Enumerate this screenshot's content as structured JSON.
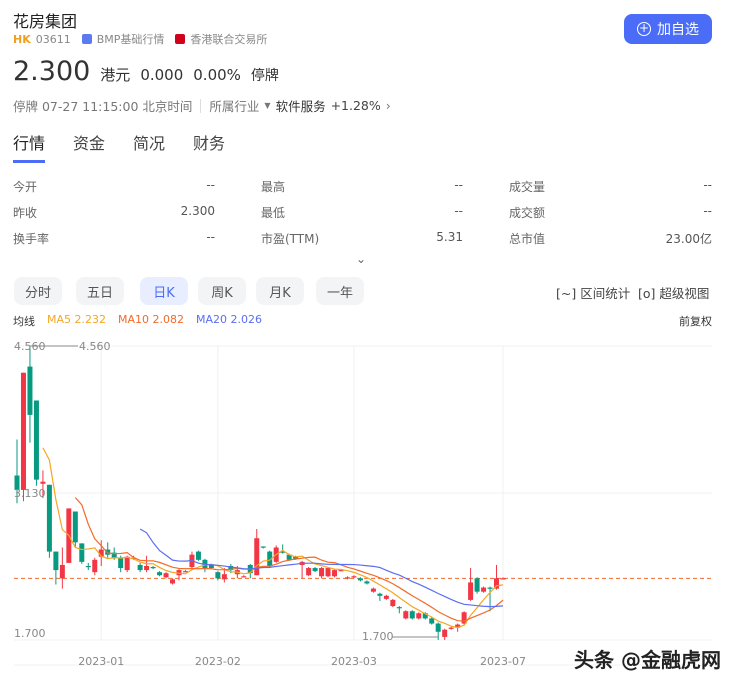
{
  "header": {
    "title": "花房集团",
    "market": "HK",
    "code": "03611",
    "feed": "BMP基础行情",
    "exchange": "香港联合交易所",
    "add_button": "加自选"
  },
  "quote": {
    "price": "2.300",
    "currency": "港元",
    "change": "0.000",
    "change_pct": "0.00%",
    "state": "停牌",
    "status_time": "停牌 07-27 11:15:00 北京时间",
    "industry_label": "所属行业",
    "industry": "软件服务",
    "industry_change": "+1.28%"
  },
  "tabs": [
    "行情",
    "资金",
    "简况",
    "财务"
  ],
  "stats": [
    [
      {
        "label": "今开",
        "value": "--"
      },
      {
        "label": "最高",
        "value": "--"
      },
      {
        "label": "成交量",
        "value": "--"
      }
    ],
    [
      {
        "label": "昨收",
        "value": "2.300"
      },
      {
        "label": "最低",
        "value": "--"
      },
      {
        "label": "成交额",
        "value": "--"
      }
    ],
    [
      {
        "label": "换手率",
        "value": "--"
      },
      {
        "label": "市盈(TTM)",
        "value": "5.31"
      },
      {
        "label": "总市值",
        "value": "23.00亿"
      }
    ]
  ],
  "periods": [
    "分时",
    "五日",
    "日K",
    "周K",
    "月K",
    "一年"
  ],
  "tools": {
    "range": "区间统计",
    "super": "超级视图"
  },
  "ma": {
    "label": "均线",
    "ma5": "MA5 2.232",
    "ma10": "MA10 2.082",
    "ma20": "MA20 2.026",
    "adjust": "前复权"
  },
  "watermark": "头条 @金融虎网",
  "colors": {
    "up": "#f23645",
    "down": "#089981",
    "ma5": "#f5a623",
    "ma10": "#f26b2a",
    "ma20": "#5b6ef5",
    "accent": "#4a6cf7"
  },
  "chart_data": {
    "type": "candlestick",
    "y_labels": [
      "4.560",
      "3.130",
      "1.700"
    ],
    "ylim": [
      1.7,
      4.56
    ],
    "x_labels": [
      {
        "label": "2023-01",
        "index": 13
      },
      {
        "label": "2023-02",
        "index": 31
      },
      {
        "label": "2023-03",
        "index": 52
      },
      {
        "label": "2023-07",
        "index": 75
      }
    ],
    "max_marker": "4.560",
    "min_marker": "1.700",
    "last_close": 2.3,
    "candles": [
      [
        3.3,
        3.65,
        3.03,
        3.16
      ],
      [
        3.16,
        4.3,
        3.05,
        4.3
      ],
      [
        4.36,
        4.56,
        3.62,
        3.89
      ],
      [
        4.03,
        4.03,
        3.2,
        3.26
      ],
      [
        3.22,
        3.35,
        3.08,
        3.24
      ],
      [
        3.21,
        3.21,
        2.5,
        2.56
      ],
      [
        2.56,
        2.56,
        2.24,
        2.38
      ],
      [
        2.3,
        2.6,
        2.2,
        2.43
      ],
      [
        2.45,
        2.98,
        2.45,
        2.98
      ],
      [
        2.95,
        2.95,
        2.6,
        2.65
      ],
      [
        2.64,
        2.64,
        2.44,
        2.46
      ],
      [
        2.42,
        2.45,
        2.38,
        2.41
      ],
      [
        2.36,
        2.5,
        2.33,
        2.48
      ],
      [
        2.51,
        2.67,
        2.42,
        2.58
      ],
      [
        2.58,
        2.65,
        2.5,
        2.53
      ],
      [
        2.55,
        2.6,
        2.48,
        2.5
      ],
      [
        2.5,
        2.52,
        2.36,
        2.4
      ],
      [
        2.38,
        2.52,
        2.36,
        2.51
      ],
      [
        2.49,
        2.52,
        2.48,
        2.5
      ],
      [
        2.43,
        2.45,
        2.36,
        2.38
      ],
      [
        2.38,
        2.52,
        2.36,
        2.42
      ],
      [
        2.41,
        2.42,
        2.39,
        2.4
      ],
      [
        2.36,
        2.37,
        2.32,
        2.33
      ],
      [
        2.31,
        2.36,
        2.3,
        2.35
      ],
      [
        2.25,
        2.3,
        2.24,
        2.29
      ],
      [
        2.33,
        2.39,
        2.28,
        2.38
      ],
      [
        2.37,
        2.38,
        2.36,
        2.37
      ],
      [
        2.41,
        2.56,
        2.4,
        2.53
      ],
      [
        2.56,
        2.57,
        2.47,
        2.48
      ],
      [
        2.48,
        2.49,
        2.36,
        2.4
      ],
      [
        2.43,
        2.44,
        2.39,
        2.4
      ],
      [
        2.36,
        2.37,
        2.28,
        2.3
      ],
      [
        2.29,
        2.4,
        2.26,
        2.34
      ],
      [
        2.42,
        2.44,
        2.35,
        2.38
      ],
      [
        2.34,
        2.42,
        2.3,
        2.38
      ],
      [
        2.32,
        2.33,
        2.31,
        2.32
      ],
      [
        2.43,
        2.44,
        2.3,
        2.35
      ],
      [
        2.33,
        2.78,
        2.33,
        2.69
      ],
      [
        2.61,
        2.61,
        2.59,
        2.6
      ],
      [
        2.56,
        2.57,
        2.4,
        2.42
      ],
      [
        2.46,
        2.62,
        2.45,
        2.6
      ],
      [
        2.56,
        2.63,
        2.54,
        2.55
      ],
      [
        2.53,
        2.54,
        2.47,
        2.48
      ],
      [
        2.51,
        2.52,
        2.48,
        2.49
      ],
      [
        2.43,
        2.47,
        2.3,
        2.46
      ],
      [
        2.33,
        2.41,
        2.32,
        2.4
      ],
      [
        2.4,
        2.41,
        2.36,
        2.37
      ],
      [
        2.32,
        2.41,
        2.3,
        2.4
      ],
      [
        2.32,
        2.41,
        2.31,
        2.4
      ],
      [
        2.32,
        2.39,
        2.31,
        2.38
      ],
      [
        2.38,
        2.39,
        2.37,
        2.38
      ],
      [
        2.3,
        2.32,
        2.29,
        2.31
      ],
      [
        2.31,
        2.33,
        2.3,
        2.32
      ],
      [
        2.3,
        2.31,
        2.27,
        2.28
      ],
      [
        2.27,
        2.28,
        2.24,
        2.25
      ],
      [
        2.17,
        2.21,
        2.16,
        2.2
      ],
      [
        2.15,
        2.16,
        2.08,
        2.13
      ],
      [
        2.1,
        2.14,
        2.09,
        2.13
      ],
      [
        2.03,
        2.1,
        2.02,
        2.09
      ],
      [
        2.02,
        2.03,
        1.96,
        2.01
      ],
      [
        1.91,
        1.99,
        1.9,
        1.98
      ],
      [
        1.98,
        1.99,
        1.9,
        1.91
      ],
      [
        1.91,
        1.97,
        1.9,
        1.96
      ],
      [
        1.96,
        1.97,
        1.9,
        1.91
      ],
      [
        1.91,
        1.92,
        1.85,
        1.86
      ],
      [
        1.86,
        1.87,
        1.7,
        1.78
      ],
      [
        1.73,
        1.81,
        1.7,
        1.8
      ],
      [
        1.81,
        1.83,
        1.8,
        1.82
      ],
      [
        1.82,
        1.86,
        1.78,
        1.85
      ],
      [
        1.86,
        1.98,
        1.85,
        1.97
      ],
      [
        2.09,
        2.4,
        2.08,
        2.26
      ],
      [
        2.3,
        2.31,
        2.15,
        2.17
      ],
      [
        2.17,
        2.22,
        2.16,
        2.21
      ],
      [
        2.21,
        2.22,
        1.98,
        2.2
      ],
      [
        2.2,
        2.43,
        2.19,
        2.3
      ],
      [
        2.3,
        2.31,
        2.29,
        2.3
      ]
    ]
  }
}
